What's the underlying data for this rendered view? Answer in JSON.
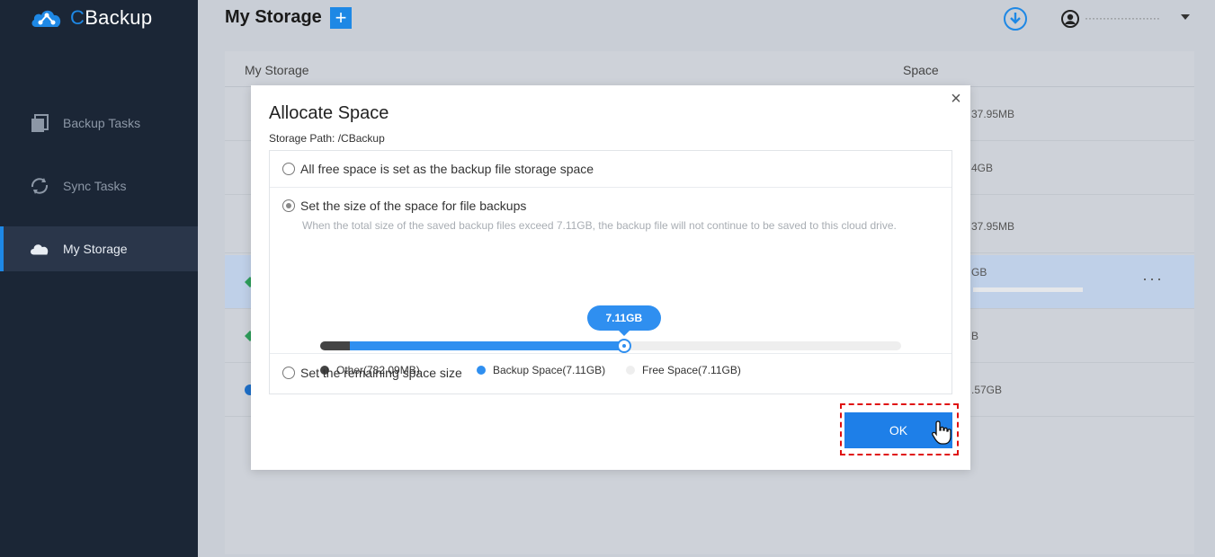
{
  "app": {
    "name_prefix": "C",
    "name_rest": "Backup"
  },
  "sidebar": {
    "items": [
      {
        "label": "Backup Tasks",
        "icon": "backup-tasks-icon"
      },
      {
        "label": "Sync Tasks",
        "icon": "sync-icon"
      },
      {
        "label": "My Storage",
        "icon": "cloud-icon",
        "active": true
      }
    ]
  },
  "header": {
    "title": "My Storage",
    "add_label": "+",
    "username": "·························...",
    "accent": "#1e88e5"
  },
  "table": {
    "col_storage": "My Storage",
    "col_space": "Space",
    "rows": [
      {
        "space": "37.95MB"
      },
      {
        "space": "4GB"
      },
      {
        "space": "37.95MB"
      },
      {
        "space": "GB",
        "more": "···"
      },
      {
        "space": "B"
      },
      {
        "space": ".57GB"
      }
    ]
  },
  "modal": {
    "title": "Allocate Space",
    "close": "×",
    "storage_path": "Storage Path: /CBackup",
    "option_all": "All free space is set as the backup file storage space",
    "option_size": "Set the size of the space for file backups",
    "option_size_hint": "When the total size of the saved backup files exceed 7.11GB, the backup file will not continue to be saved to this cloud drive.",
    "option_remaining": "Set the remaining space size",
    "slider_value": "7.11GB",
    "slider_fraction": 0.523,
    "legend": {
      "other": "Other(782.09MB)",
      "backup": "Backup Space(7.11GB)",
      "free": "Free Space(7.11GB)"
    },
    "ok_label": "OK"
  }
}
